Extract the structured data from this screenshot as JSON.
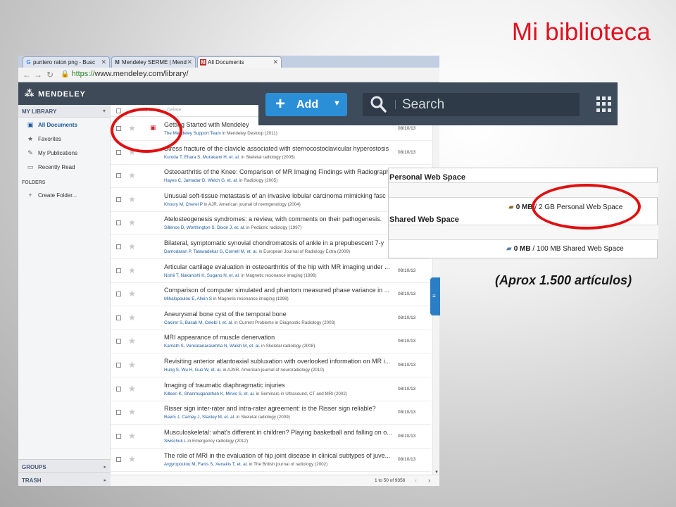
{
  "slide": {
    "title": "Mi biblioteca",
    "caption": "(Aprox 1.500 artículos)"
  },
  "browser": {
    "tabs": [
      {
        "label": "puntero raton png - Busc",
        "favicon": "G"
      },
      {
        "label": "Mendeley SERME | Mend",
        "favicon": "M"
      },
      {
        "label": "All Documents",
        "favicon": "M"
      }
    ],
    "url_scheme": "https://",
    "url_rest": "www.mendeley.com/library/"
  },
  "mendeley": {
    "logo_text": "MENDELEY",
    "sidebar": {
      "my_library": "MY LIBRARY",
      "items": [
        {
          "label": "All Documents",
          "icon": "documents-icon"
        },
        {
          "label": "Favorites",
          "icon": "star-icon"
        },
        {
          "label": "My Publications",
          "icon": "publications-icon"
        },
        {
          "label": "Recently Read",
          "icon": "book-icon"
        }
      ],
      "folders_label": "FOLDERS",
      "create_folder": "Create Folder...",
      "groups": "GROUPS",
      "trash": "TRASH"
    },
    "toolbar_faded": [
      "Add to",
      "Delete"
    ],
    "documents": [
      {
        "title": "Getting Started with Mendeley",
        "authors": "The Mendeley Support Team",
        "source": "in Mendeley Desktop (2011)",
        "date": "08/10/13",
        "pdf": true
      },
      {
        "title": "Stress fracture of the clavicle associated with sternocostoclavicular hyperostosis",
        "authors": "Kuroda T, Ehara S, Murakami H, et. al.",
        "source": "in Skeletal radiology (2005)",
        "date": "08/10/13",
        "pdf": false
      },
      {
        "title": "Osteoarthritis of the Knee: Comparison of MR Imaging Findings with Radiographic",
        "authors": "Hayes C, Jamadar D, Welch G, et. al.",
        "source": "in Radiology (2005)",
        "date": "",
        "pdf": false
      },
      {
        "title": "Unusual soft-tissue metastasis of an invasive lobular carcinoma mimicking fasc",
        "authors": "Khoury M, Cherel P",
        "source": "in AJR. American journal of roentgenology (2004)",
        "date": "",
        "pdf": false
      },
      {
        "title": "Atelosteogenesis syndromes: a review, with comments on their pathogenesis.",
        "authors": "Sillence D, Worthington S, Dixon J, et. al.",
        "source": "in Pediatric radiology (1997)",
        "date": "",
        "pdf": false
      },
      {
        "title": "Bilateral, symptomatic synovial chondromatosis of ankle in a prepubescent 7-y",
        "authors": "Damodaran P, Talawadekar G, Cornell M, et. al.",
        "source": "in European Journal of Radiology Extra (2009)",
        "date": "",
        "pdf": false
      },
      {
        "title": "Articular cartilage evaluation in osteoarthritis of the hip with MR imaging under ...",
        "authors": "Nishii T, Nakanishi K, Sugano N, et. al.",
        "source": "in Magnetic resonance imaging (1996)",
        "date": "08/10/13",
        "pdf": false
      },
      {
        "title": "Comparison of computer simulated and phantom measured phase variance in ...",
        "authors": "Mihalopoulou E, Allein S",
        "source": "in Magnetic resonance imaging (1998)",
        "date": "08/10/13",
        "pdf": false
      },
      {
        "title": "Aneurysmal bone cyst of the temporal bone",
        "authors": "Cakirer S, Basak M, Celebi I, et. al.",
        "source": "in Current Problems in Diagnostic Radiology (2003)",
        "date": "08/10/13",
        "pdf": false
      },
      {
        "title": "MRI appearance of muscle denervation",
        "authors": "Kamath S, Venkatanarasimha N, Walsh M, et. al.",
        "source": "in Skeletal radiology (2008)",
        "date": "08/10/13",
        "pdf": false
      },
      {
        "title": "Revisiting anterior atlantoaxial subluxation with overlooked information on MR i...",
        "authors": "Hung S, Wu H, Guo W, et. al.",
        "source": "in AJNR. American journal of neuroradiology (2010)",
        "date": "08/10/13",
        "pdf": false
      },
      {
        "title": "Imaging of traumatic diaphragmatic injuries",
        "authors": "Killeen K, Shanmuganathan K, Mirvis S, et. al.",
        "source": "in Seminars in Ultrasound, CT and MRI (2002)",
        "date": "08/10/13",
        "pdf": false
      },
      {
        "title": "Risser sign inter-rater and intra-rater agreement: is the Risser sign reliable?",
        "authors": "Reem J, Carney J, Stanley M, et. al.",
        "source": "in Skeletal radiology (2009)",
        "date": "08/10/13",
        "pdf": false
      },
      {
        "title": "Musculoskeletal: what's different in children? Playing basketball and falling on o...",
        "authors": "Swischuk L",
        "source": "in Emergency radiology (2012)",
        "date": "08/10/13",
        "pdf": false
      },
      {
        "title": "The role of MRI in the evaluation of hip joint disease in clinical subtypes of juve...",
        "authors": "Argyropoulou M, Fanis S, Xenakis T, et. al.",
        "source": "in The British journal of radiology (2002)",
        "date": "08/10/13",
        "pdf": false
      }
    ],
    "pagination": "1 to 50 of 9356"
  },
  "zoom_toolbar": {
    "add_label": "Add",
    "search_placeholder": "Search"
  },
  "web_space": {
    "personal_title": "Personal Web Space",
    "personal_used": "0 MB",
    "personal_total": "/ 2 GB Personal Web Space",
    "shared_title": "Shared Web Space",
    "shared_used": "0 MB",
    "shared_total": "/ 100 MB Shared Web Space"
  },
  "colors": {
    "title_red": "#e0101e",
    "mendeley_header": "#3e4a58",
    "add_button_blue": "#2b8fd8",
    "highlight_ring": "#e01010"
  }
}
